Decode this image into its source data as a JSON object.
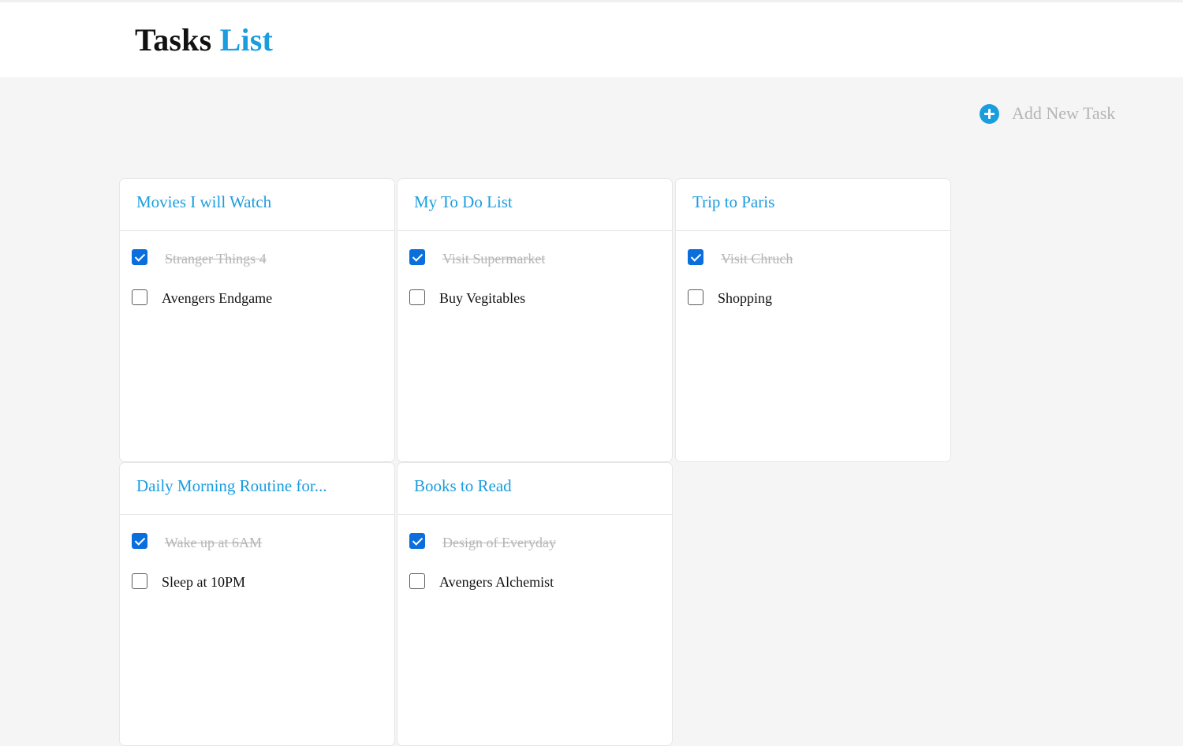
{
  "header": {
    "title_main": "Tasks",
    "title_accent": "List"
  },
  "add_task": {
    "label": "Add New Task",
    "icon": "plus-circle-icon"
  },
  "colors": {
    "accent": "#1a9ddf",
    "checkbox": "#0a6fdc",
    "done_text": "#b5b5b5"
  },
  "cards": [
    {
      "title": "Movies I will Watch",
      "tasks": [
        {
          "label": "Stranger Things 4",
          "done": true
        },
        {
          "label": "Avengers Endgame",
          "done": false
        }
      ]
    },
    {
      "title": "My To Do List",
      "tasks": [
        {
          "label": "Visit Supermarket",
          "done": true
        },
        {
          "label": "Buy Vegitables",
          "done": false
        }
      ]
    },
    {
      "title": "Trip to Paris",
      "tasks": [
        {
          "label": "Visit Chruch",
          "done": true
        },
        {
          "label": "Shopping",
          "done": false
        }
      ]
    },
    {
      "title": "Daily Morning Routine for...",
      "tasks": [
        {
          "label": "Wake up at 6AM",
          "done": true
        },
        {
          "label": "Sleep at 10PM",
          "done": false
        }
      ]
    },
    {
      "title": "Books to Read",
      "tasks": [
        {
          "label": "Design of Everyday",
          "done": true
        },
        {
          "label": "Avengers Alchemist",
          "done": false
        }
      ]
    }
  ]
}
